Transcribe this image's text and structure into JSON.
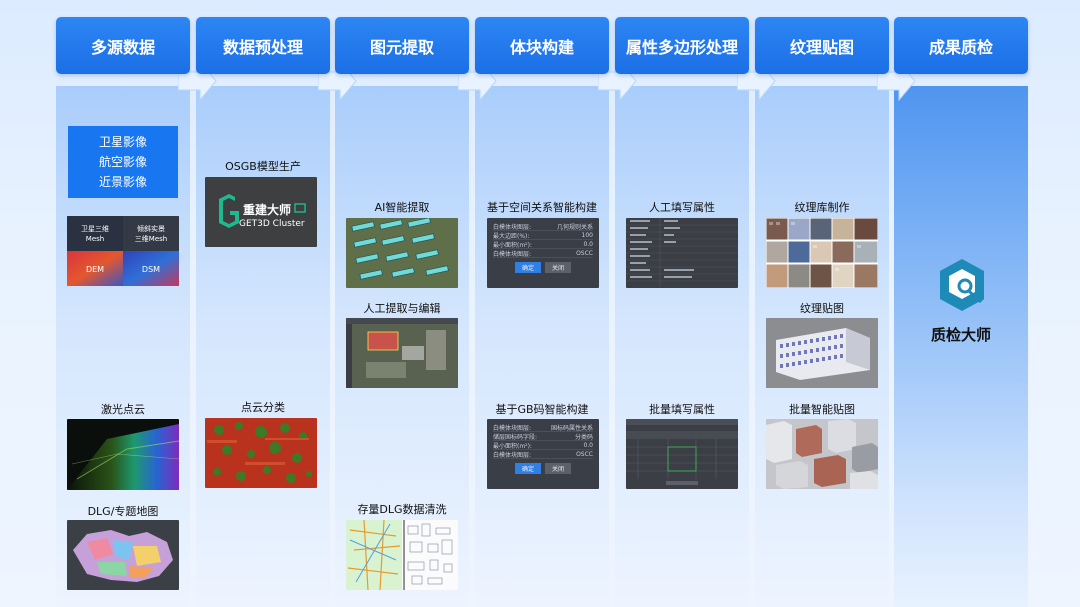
{
  "steps": [
    {
      "label": "多源数据"
    },
    {
      "label": "数据预处理"
    },
    {
      "label": "图元提取"
    },
    {
      "label": "体块构建"
    },
    {
      "label": "属性多边形处理"
    },
    {
      "label": "纹理贴图"
    },
    {
      "label": "成果质检"
    }
  ],
  "col1": {
    "imagery_list": [
      "卫星影像",
      "航空影像",
      "近景影像"
    ],
    "mesh_tile": {
      "tl": "卫星三维",
      "tl2": "Mesh",
      "tr": "倾斜实景",
      "tr2": "三维Mesh",
      "bl": "DEM",
      "br": "DSM"
    },
    "lidar_label": "激光点云",
    "dlg_label": "DLG/专题地图"
  },
  "col2": {
    "osgb_label": "OSGB模型生产",
    "logo_text": "重建大师",
    "logo_sub": "GET3D Cluster",
    "pointcloud_label": "点云分类"
  },
  "col3": {
    "ai_label": "AI智能提取",
    "manual_label": "人工提取与编辑",
    "dlg_clean_label": "存量DLG数据清洗"
  },
  "col4": {
    "spatial_label": "基于空间关系智能构建",
    "gb_label": "基于GB码智能构建",
    "dialog1": {
      "rows": [
        [
          "白模体块图层:",
          "几何规则关系"
        ],
        [
          "最大边距(%):",
          "100"
        ],
        [
          "最小面积(m²):",
          "0.0"
        ],
        [
          "白模体块图层:",
          "OSCC"
        ]
      ],
      "ok": "确定",
      "cancel": "关闭"
    },
    "dialog2": {
      "rows": [
        [
          "白模体块图层:",
          "国标码属性关系"
        ],
        [
          "储层国标码字段:",
          "分类码"
        ],
        [
          "最小面积(m²):",
          "0.0"
        ],
        [
          "白模体块图层:",
          "OSCC"
        ]
      ],
      "ok": "确定",
      "cancel": "关闭"
    }
  },
  "col5": {
    "manual_attr_label": "人工填写属性",
    "batch_attr_label": "批量填写属性"
  },
  "col6": {
    "texlib_label": "纹理库制作",
    "texmap_label": "纹理贴图",
    "smart_tex_label": "批量智能贴图"
  },
  "col7": {
    "qc_label": "质检大师"
  },
  "colors": {
    "header": "#1b6fe6",
    "accent": "#1876f0",
    "qc_icon": "#1d8ab7"
  }
}
